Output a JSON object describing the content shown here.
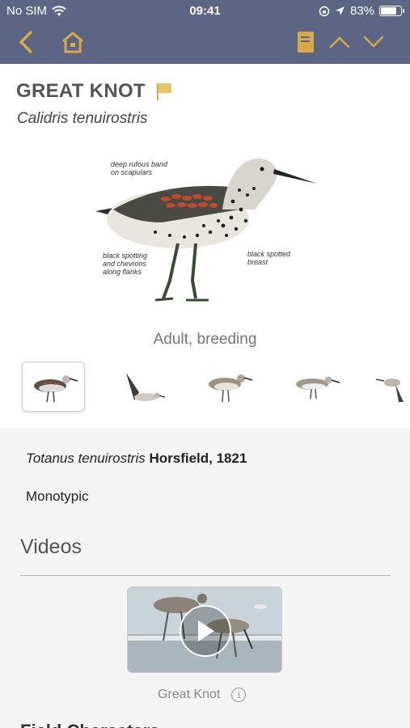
{
  "status": {
    "carrier": "No SIM",
    "time": "09:41",
    "battery": "83%",
    "battery_level": 0.83
  },
  "nav": {
    "back": "back",
    "home": "home",
    "notes": "notes",
    "prev": "previous",
    "next": "next"
  },
  "species": {
    "common_name": "GREAT KNOT",
    "scientific_name": "Calidris tenuirostris",
    "plate_caption": "Adult, breeding",
    "annotations": {
      "scapulars": "deep rufous band\non scapulars",
      "flanks": "black spotting\nand chevrons\nalong flanks",
      "breast": "black spotted\nbreast"
    }
  },
  "thumbnails": [
    "Adult, breeding",
    "flight",
    "adult",
    "adult",
    "flight"
  ],
  "taxonomy": {
    "original_name": "Totanus tenuirostris",
    "authority": "Horsfield, 1821",
    "subspecies": "Monotypic"
  },
  "videos": {
    "heading": "Videos",
    "caption": "Great Knot"
  },
  "next_section": "Field Characters",
  "colors": {
    "nav_bar": "#5c6584",
    "accent": "#d9a84a"
  }
}
